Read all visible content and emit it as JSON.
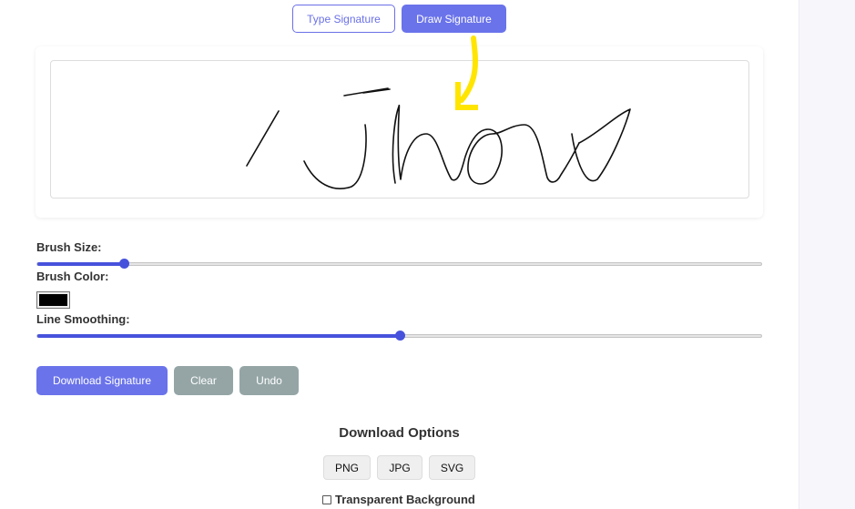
{
  "tabs": {
    "type_label": "Type Signature",
    "draw_label": "Draw Signature",
    "active": "Draw Signature"
  },
  "annotation": {
    "icon": "arrow-down-icon",
    "color": "#FFE500"
  },
  "controls": {
    "brush_size_label": "Brush Size:",
    "brush_size_fraction": 0.12,
    "brush_color_label": "Brush Color:",
    "brush_color": "#000000",
    "smoothing_label": "Line Smoothing:",
    "smoothing_fraction": 0.5
  },
  "actions": {
    "download": "Download Signature",
    "clear": "Clear",
    "undo": "Undo"
  },
  "download_options": {
    "title": "Download Options",
    "formats": [
      "PNG",
      "JPG",
      "SVG"
    ],
    "transparent_label": "Transparent Background",
    "transparent_checked": false
  },
  "colors": {
    "accent": "#6a73ea",
    "slider": "#4752dc",
    "secondary": "#95a5a6"
  }
}
